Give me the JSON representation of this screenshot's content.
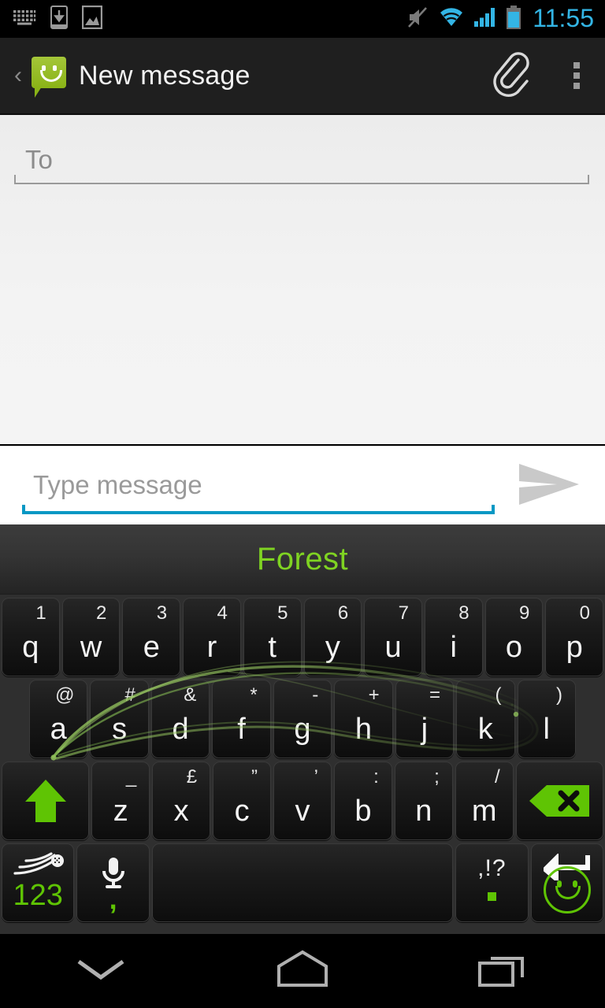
{
  "status_bar": {
    "time": "11:55",
    "left_icons": [
      {
        "name": "keyboard-icon",
        "label": "keyboard"
      },
      {
        "name": "usb-download-icon",
        "label": "download"
      },
      {
        "name": "screenshot-image-icon",
        "label": "screenshot"
      }
    ],
    "right_icons": [
      {
        "name": "mute-icon",
        "label": "silent"
      },
      {
        "name": "wifi-icon",
        "label": "wifi"
      },
      {
        "name": "cellular-signal-icon",
        "label": "signal"
      },
      {
        "name": "battery-icon",
        "label": "battery"
      }
    ],
    "accent_color": "#33B5E5",
    "icon_color": "#9a9a9a",
    "background": "#000000"
  },
  "action_bar": {
    "back_glyph": "‹",
    "app_icon": "messaging-bubble-smiley-icon",
    "title": "New message",
    "attach_label": "attach",
    "overflow_label": "more options",
    "background": "#1F1F1F",
    "title_color": "#F2F2F2"
  },
  "compose": {
    "recipient": {
      "value": "",
      "placeholder": "To",
      "underline_color": "#9A9A9A"
    },
    "message": {
      "value": "",
      "placeholder": "Type message",
      "underline_color": "#0798C4"
    },
    "send_label": "Send",
    "background": "#ECECEC"
  },
  "keyboard": {
    "type": "swype",
    "suggestion": "Forest",
    "suggestion_color": "#7FD322",
    "trail_color": "#8FBF5A",
    "background": "#2F2F2F",
    "rows": [
      {
        "name": "row-1",
        "keys": [
          {
            "main": "q",
            "alt": "1"
          },
          {
            "main": "w",
            "alt": "2"
          },
          {
            "main": "e",
            "alt": "3"
          },
          {
            "main": "r",
            "alt": "4"
          },
          {
            "main": "t",
            "alt": "5"
          },
          {
            "main": "y",
            "alt": "6"
          },
          {
            "main": "u",
            "alt": "7"
          },
          {
            "main": "i",
            "alt": "8"
          },
          {
            "main": "o",
            "alt": "9"
          },
          {
            "main": "p",
            "alt": "0"
          }
        ]
      },
      {
        "name": "row-2",
        "keys": [
          {
            "main": "a",
            "alt": "@"
          },
          {
            "main": "s",
            "alt": "#"
          },
          {
            "main": "d",
            "alt": "&"
          },
          {
            "main": "f",
            "alt": "*"
          },
          {
            "main": "g",
            "alt": "-"
          },
          {
            "main": "h",
            "alt": "+"
          },
          {
            "main": "j",
            "alt": "="
          },
          {
            "main": "k",
            "alt": "("
          },
          {
            "main": "l",
            "alt": ")"
          }
        ]
      },
      {
        "name": "row-3",
        "keys": [
          {
            "main": "",
            "alt": "",
            "icon": "shift-icon",
            "wide": true
          },
          {
            "main": "z",
            "alt": "_"
          },
          {
            "main": "x",
            "alt": "£"
          },
          {
            "main": "c",
            "alt": "”"
          },
          {
            "main": "v",
            "alt": "’"
          },
          {
            "main": "b",
            "alt": ":"
          },
          {
            "main": "n",
            "alt": ";"
          },
          {
            "main": "m",
            "alt": "/"
          },
          {
            "main": "",
            "alt": "",
            "icon": "backspace-icon",
            "wide": true
          }
        ]
      },
      {
        "name": "row-4",
        "keys": [
          {
            "main": "123",
            "alt": "",
            "icon": "swype-logo-icon"
          },
          {
            "main": ",",
            "alt": "",
            "icon": "microphone-icon"
          },
          {
            "main": "",
            "alt": "",
            "icon": "space-key",
            "space": true
          },
          {
            "main": ".",
            "alt": ",!?",
            "icon": "punctuation-key"
          },
          {
            "main": "",
            "alt": "",
            "icon": "enter-emoji-icon"
          }
        ]
      }
    ]
  },
  "nav_bar": {
    "buttons": [
      {
        "name": "hide-keyboard-button",
        "label": "hide keyboard"
      },
      {
        "name": "home-button",
        "label": "home"
      },
      {
        "name": "recents-button",
        "label": "recent apps"
      }
    ],
    "icon_color": "#B0B0B0",
    "background": "#000000"
  }
}
